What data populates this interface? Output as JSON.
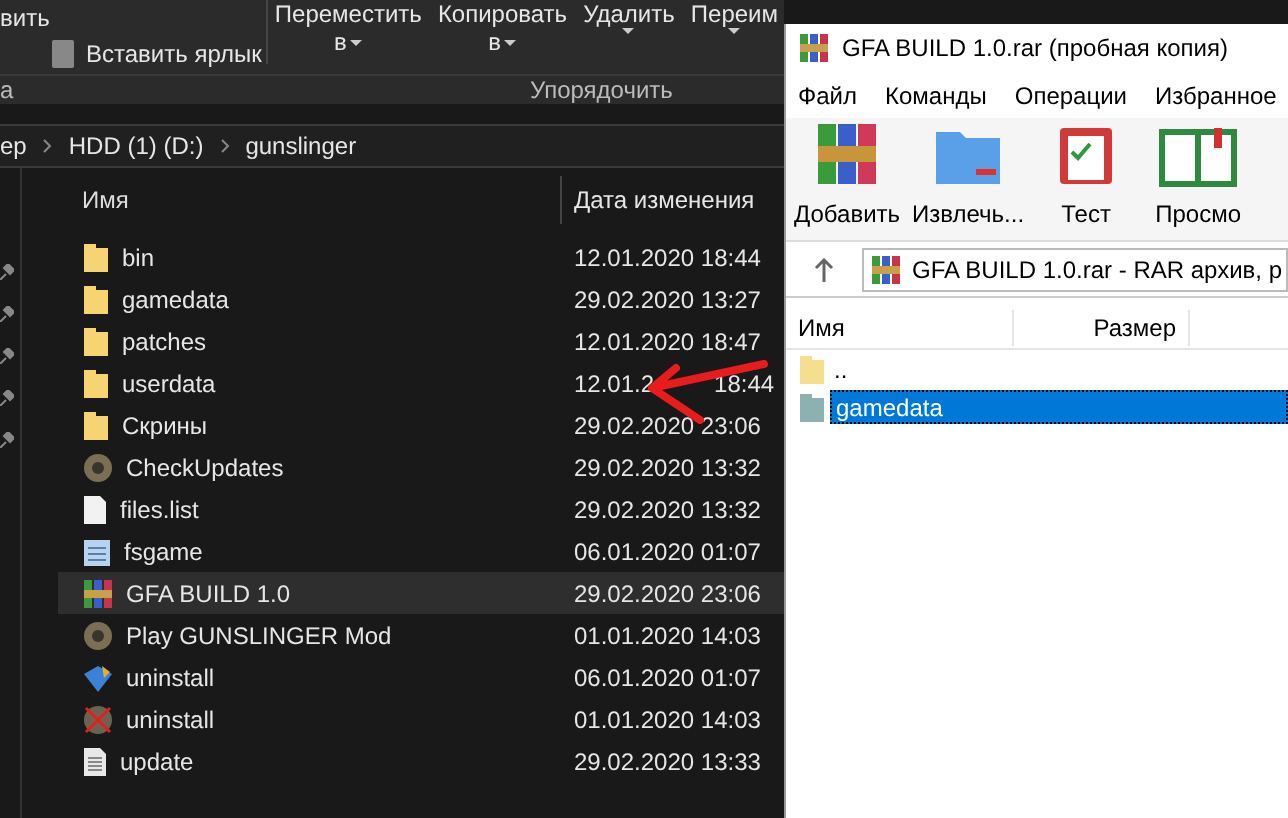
{
  "explorer": {
    "ribbon": {
      "paste_cut": "вить",
      "paste_shortcut": "Вставить ярлык",
      "buttons": [
        {
          "label": "Переместить",
          "sub": "в"
        },
        {
          "label": "Копировать",
          "sub": "в"
        },
        {
          "label": "Удалить"
        },
        {
          "label": "Переим"
        }
      ],
      "groups": [
        "а",
        "Упорядочить"
      ]
    },
    "breadcrumb": [
      "ер",
      "HDD (1) (D:)",
      "gunslinger"
    ],
    "columns": [
      "Имя",
      "Дата изменения"
    ],
    "rows": [
      {
        "kind": "folder",
        "name": "bin",
        "date": "12.01.2020 18:44",
        "selected": false
      },
      {
        "kind": "folder",
        "name": "gamedata",
        "date": "29.02.2020 13:27",
        "selected": false
      },
      {
        "kind": "folder",
        "name": "patches",
        "date": "12.01.2020 18:47",
        "selected": false
      },
      {
        "kind": "folder",
        "name": "userdata",
        "date": "12.01.2",
        "date_rest": "18:44",
        "selected": false
      },
      {
        "kind": "folder",
        "name": "Скрины",
        "date": "29.02.2020 23:06",
        "selected": false
      },
      {
        "kind": "app",
        "name": "CheckUpdates",
        "date": "29.02.2020 13:32",
        "selected": false
      },
      {
        "kind": "file",
        "name": "files.list",
        "date": "29.02.2020 13:32",
        "selected": false
      },
      {
        "kind": "config",
        "name": "fsgame",
        "date": "06.01.2020 01:07",
        "selected": false
      },
      {
        "kind": "archive",
        "name": "GFA BUILD 1.0",
        "date": "29.02.2020 23:06",
        "selected": true
      },
      {
        "kind": "app",
        "name": "Play GUNSLINGER Mod",
        "date": "01.01.2020 14:03",
        "selected": false
      },
      {
        "kind": "installer",
        "name": "uninstall",
        "date": "06.01.2020 01:07",
        "selected": false
      },
      {
        "kind": "uninstaller",
        "name": "uninstall",
        "date": "01.01.2020 14:03",
        "selected": false
      },
      {
        "kind": "text",
        "name": "update",
        "date": "29.02.2020 13:33",
        "selected": false
      }
    ]
  },
  "winrar": {
    "title": "GFA BUILD 1.0.rar (пробная копия)",
    "menu": [
      "Файл",
      "Команды",
      "Операции",
      "Избранное"
    ],
    "toolbar": [
      {
        "kind": "add",
        "label": "Добавить"
      },
      {
        "kind": "extract",
        "label": "Извлечь..."
      },
      {
        "kind": "test",
        "label": "Тест"
      },
      {
        "kind": "view",
        "label": "Просмо"
      }
    ],
    "path": "GFA BUILD 1.0.rar - RAR архив, р",
    "columns": [
      "Имя",
      "Размер"
    ],
    "rows": [
      {
        "kind": "up",
        "name": "..",
        "selected": false
      },
      {
        "kind": "folder",
        "name": "gamedata",
        "selected": true
      }
    ]
  }
}
